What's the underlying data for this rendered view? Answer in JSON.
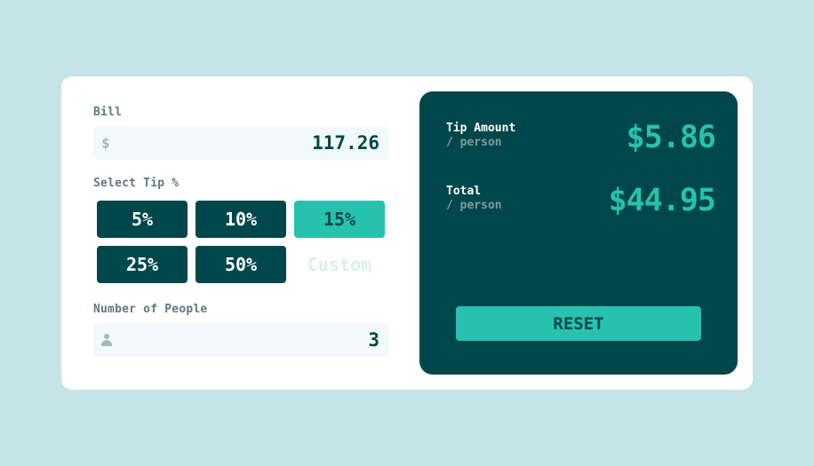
{
  "bill": {
    "label": "Bill",
    "currency_symbol": "$",
    "value": "117.26"
  },
  "tip": {
    "label": "Select Tip %",
    "options": [
      "5%",
      "10%",
      "15%",
      "25%",
      "50%"
    ],
    "selected": "15%",
    "custom_placeholder": "Custom"
  },
  "people": {
    "label": "Number of People",
    "value": "3"
  },
  "results": {
    "tip_amount_label": "Tip Amount",
    "tip_amount_sub": "/ person",
    "tip_amount_value": "$5.86",
    "total_label": "Total",
    "total_sub": "/ person",
    "total_value": "$44.95",
    "reset_label": "RESET"
  },
  "colors": {
    "background": "#c5e4e7",
    "dark_cyan": "#00474b",
    "accent": "#26c2ad",
    "card": "#ffffff",
    "input_bg": "#f3f9fa"
  }
}
